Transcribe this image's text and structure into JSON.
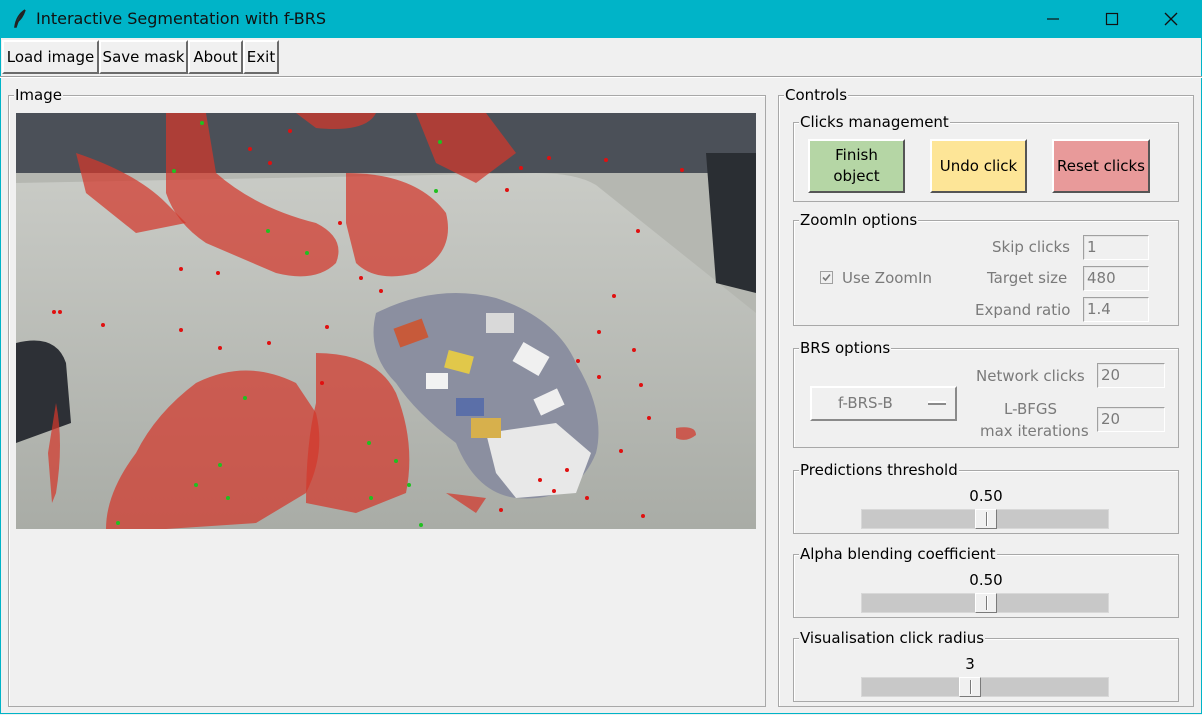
{
  "window": {
    "title": "Interactive Segmentation with f-BRS",
    "title_bar_color": "#00b4c8",
    "controls": [
      "minimize-icon",
      "maximize-icon",
      "close-icon"
    ]
  },
  "menu": {
    "items": [
      {
        "label": "Load image"
      },
      {
        "label": "Save mask"
      },
      {
        "label": "About"
      },
      {
        "label": "Exit"
      }
    ]
  },
  "image_panel": {
    "legend": "Image",
    "mask_color": "#d2382b",
    "positive_click_color": "#20c020",
    "negative_click_color": "#e01010"
  },
  "controls": {
    "legend": "Controls",
    "clicks_management": {
      "legend": "Clicks management",
      "finish_label": "Finish\nobject",
      "undo_label": "Undo click",
      "reset_label": "Reset clicks",
      "finish_color": "#b5d6a5",
      "undo_color": "#fde597",
      "reset_color": "#e89a9a"
    },
    "zoomin": {
      "legend": "ZoomIn options",
      "use_zoomin_label": "Use ZoomIn",
      "use_zoomin_checked": true,
      "skip_clicks_label": "Skip clicks",
      "skip_clicks_value": "1",
      "target_size_label": "Target size",
      "target_size_value": "480",
      "expand_ratio_label": "Expand ratio",
      "expand_ratio_value": "1.4"
    },
    "brs": {
      "legend": "BRS options",
      "mode": "f-BRS-B",
      "network_clicks_label": "Network clicks",
      "network_clicks_value": "20",
      "lbfgs_label_1": "L-BFGS",
      "lbfgs_label_2": "max iterations",
      "lbfgs_value": "20"
    },
    "threshold": {
      "legend": "Predictions threshold",
      "value_text": "0.50",
      "value": 0.5
    },
    "alpha": {
      "legend": "Alpha blending coefficient",
      "value_text": "0.50",
      "value": 0.5
    },
    "radius": {
      "legend": "Visualisation click radius",
      "value_text": "3",
      "fraction": 0.4
    }
  }
}
